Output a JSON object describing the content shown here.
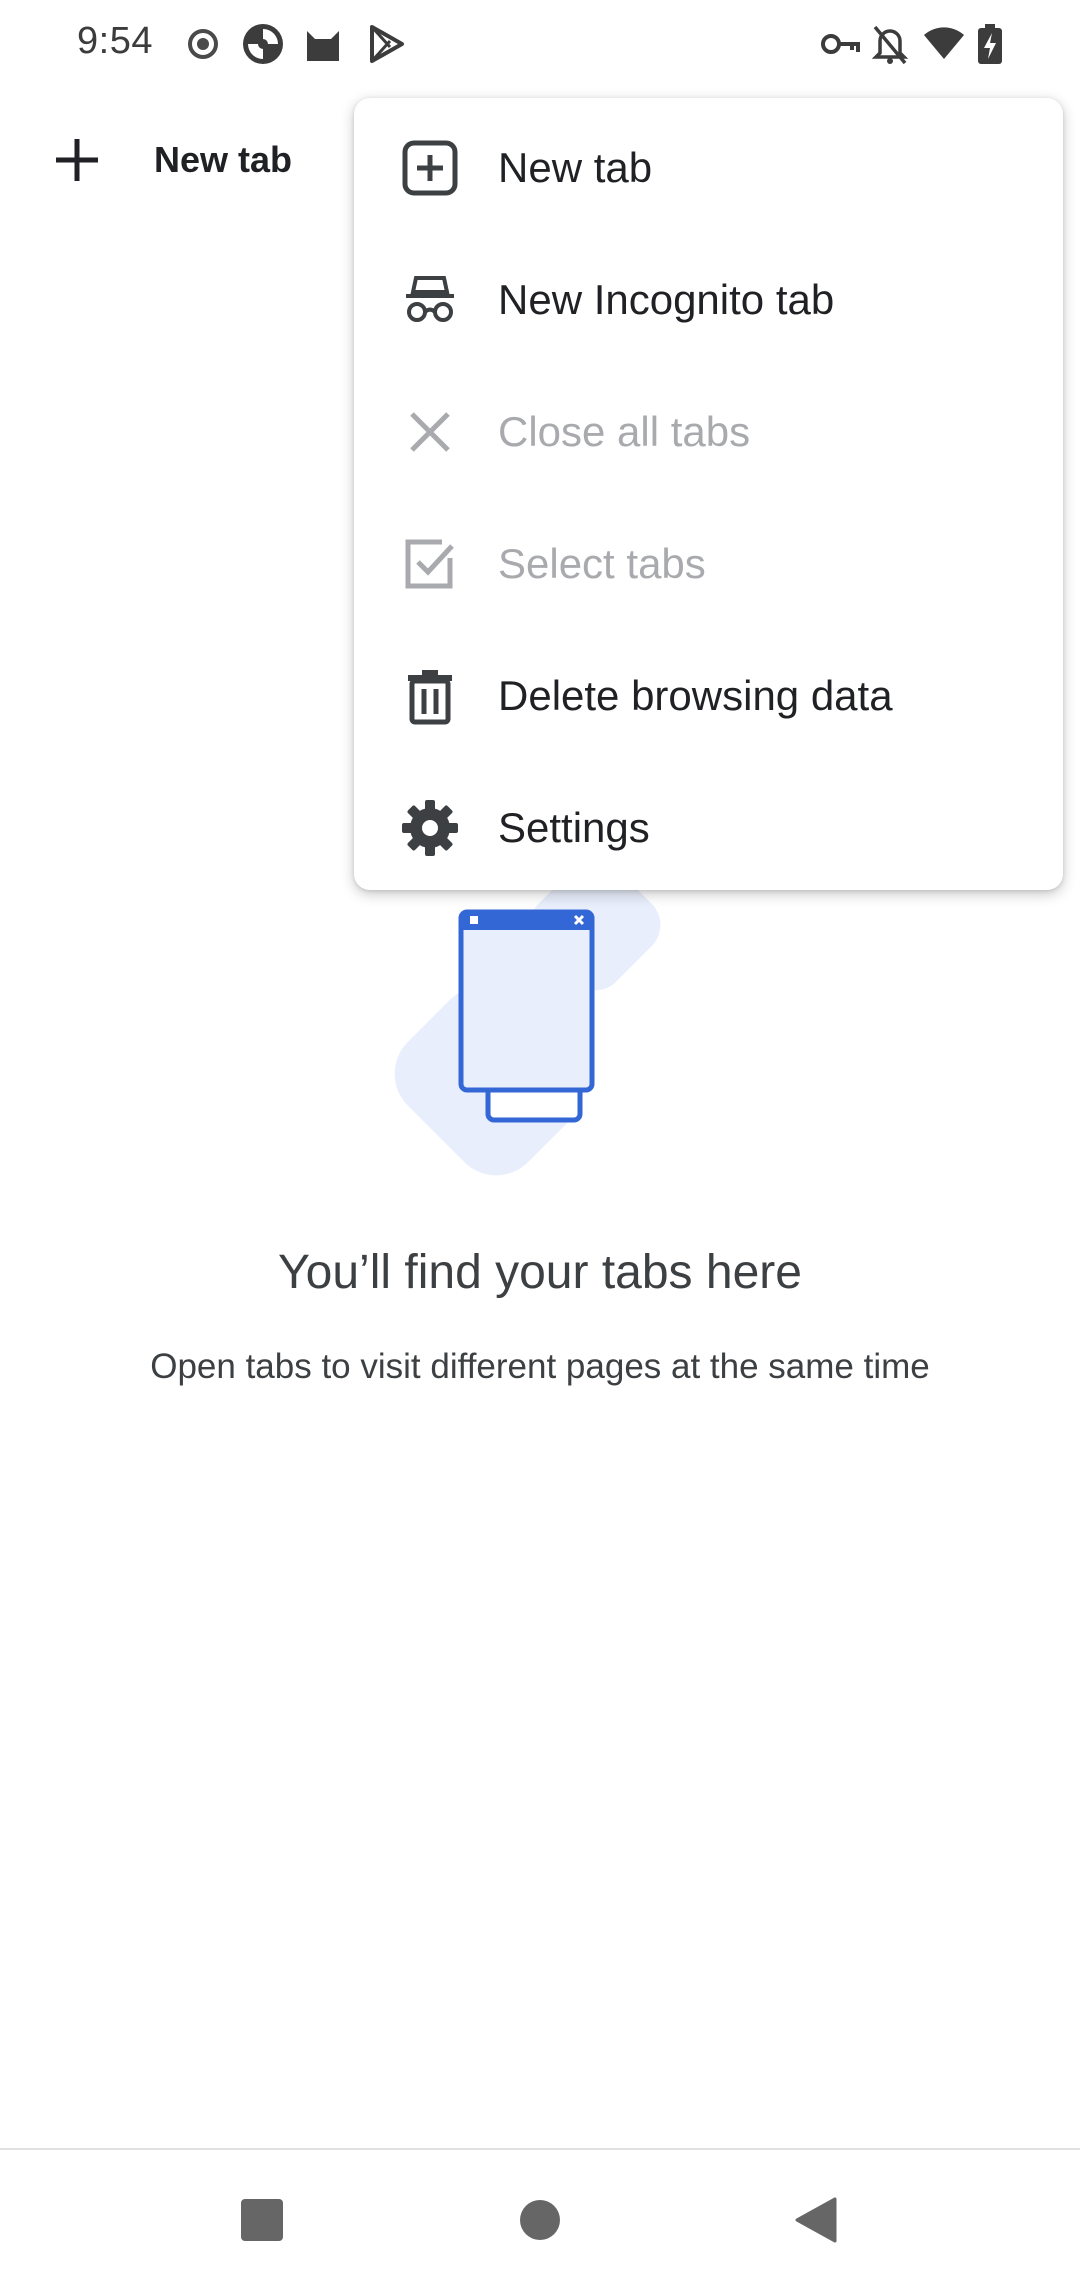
{
  "status_bar": {
    "time": "9:54",
    "icons": [
      "record-icon",
      "app-icon",
      "cat-icon",
      "play-store-icon",
      "vpn-key-icon",
      "notifications-off-icon",
      "wifi-icon",
      "battery-charging-icon"
    ]
  },
  "toolbar": {
    "new_tab_label": "New tab"
  },
  "menu": {
    "items": [
      {
        "label": "New tab",
        "icon": "add-box-icon",
        "enabled": true
      },
      {
        "label": "New Incognito tab",
        "icon": "incognito-icon",
        "enabled": true
      },
      {
        "label": "Close all tabs",
        "icon": "close-icon",
        "enabled": false
      },
      {
        "label": "Select tabs",
        "icon": "checkbox-icon",
        "enabled": false
      },
      {
        "label": "Delete browsing data",
        "icon": "trash-icon",
        "enabled": true
      },
      {
        "label": "Settings",
        "icon": "gear-icon",
        "enabled": true
      }
    ]
  },
  "empty_state": {
    "title": "You’ll find your tabs here",
    "subtitle": "Open tabs to visit different pages at the same time"
  },
  "nav_bar": {
    "buttons": [
      "recents-icon",
      "home-icon",
      "back-icon"
    ]
  },
  "colors": {
    "accent_blue": "#3367d6",
    "illustration_bg": "#e8eefb",
    "text_primary": "#202124",
    "text_disabled": "#a8aaad",
    "icon_dark": "#3c4043"
  }
}
